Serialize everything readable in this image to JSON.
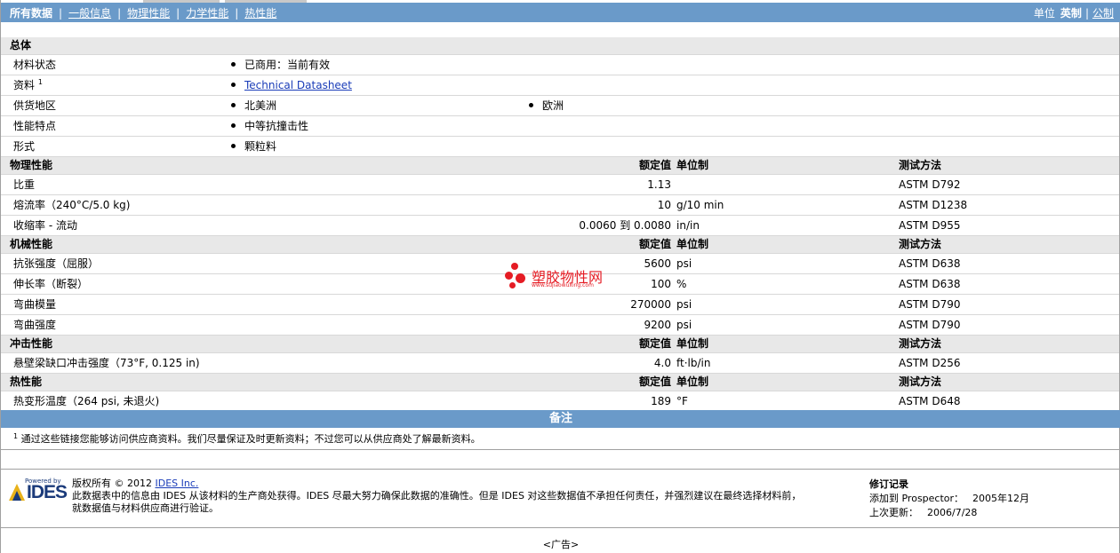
{
  "nav": {
    "items": [
      {
        "label": "所有数据",
        "active": true
      },
      {
        "label": "一般信息",
        "active": false
      },
      {
        "label": "物理性能",
        "active": false
      },
      {
        "label": "力学性能",
        "active": false
      },
      {
        "label": "热性能",
        "active": false
      }
    ],
    "unit_label": "单位",
    "unit_english": "英制",
    "unit_metric": "公制"
  },
  "general": {
    "header": "总体",
    "rows": [
      {
        "name": "材料状态",
        "values": [
          "已商用：当前有效"
        ]
      },
      {
        "name": "资料",
        "sup": "1",
        "values": [],
        "link": "Technical Datasheet"
      },
      {
        "name": "供货地区",
        "values": [
          "北美洲",
          "欧洲"
        ]
      },
      {
        "name": "性能特点",
        "values": [
          "中等抗撞击性"
        ]
      },
      {
        "name": "形式",
        "values": [
          "颗粒料"
        ]
      }
    ]
  },
  "column_headers": {
    "value": "额定值",
    "unit": "单位制",
    "method": "测试方法"
  },
  "sections": [
    {
      "header": "物理性能",
      "rows": [
        {
          "name": "比重",
          "value": "1.13",
          "unit": "",
          "method": "ASTM D792"
        },
        {
          "name": "熔流率（240°C/5.0 kg)",
          "value": "10",
          "unit": "g/10 min",
          "method": "ASTM D1238"
        },
        {
          "name": "收缩率 - 流动",
          "value": "0.0060 到  0.0080",
          "unit": "in/in",
          "method": "ASTM D955"
        }
      ]
    },
    {
      "header": "机械性能",
      "rows": [
        {
          "name": "抗张强度（屈服）",
          "value": "5600",
          "unit": "psi",
          "method": "ASTM D638"
        },
        {
          "name": "伸长率（断裂）",
          "value": "100",
          "unit": "%",
          "method": "ASTM D638"
        },
        {
          "name": "弯曲模量",
          "value": "270000",
          "unit": "psi",
          "method": "ASTM D790"
        },
        {
          "name": "弯曲强度",
          "value": "9200",
          "unit": "psi",
          "method": "ASTM D790"
        }
      ]
    },
    {
      "header": "冲击性能",
      "rows": [
        {
          "name": "悬壁梁缺口冲击强度（73°F, 0.125 in)",
          "value": "4.0",
          "unit": "ft·lb/in",
          "method": "ASTM D256"
        }
      ]
    },
    {
      "header": "热性能",
      "rows": [
        {
          "name": "热变形温度（264 psi, 未退火)",
          "value": "189",
          "unit": "°F",
          "method": "ASTM D648"
        }
      ]
    }
  ],
  "watermark": {
    "name": "塑胶物性网",
    "url": "www.sujiaowuxing.com",
    "color": "#e51c24"
  },
  "notes": {
    "header": "备注",
    "footnote_num": "1",
    "footnote": "通过这些链接您能够访问供应商资料。我们尽量保证及时更新资料；不过您可以从供应商处了解最新资料。"
  },
  "footer": {
    "powered_by": "Powered by",
    "logo_text": "IDES",
    "copyright_prefix": "版权所有  © 2012 ",
    "company_link": "IDES Inc.",
    "disclaimer_line1": "此数据表中的信息由  IDES 从该材料的生产商处获得。IDES 尽最大努力确保此数据的准确性。但是  IDES 对这些数据值不承担任何责任，并强烈建议在最终选择材料前，",
    "disclaimer_line2": "就数据值与材料供应商进行验证。"
  },
  "revision": {
    "title": "修订记录",
    "added_label": "添加到  Prospector：",
    "added_value": "2005年12月",
    "updated_label": "上次更新：",
    "updated_value": "2006/7/28"
  },
  "ad": "<广告>",
  "colors": {
    "bar": "#6a9ac9",
    "header_row": "#e8e8e8",
    "link": "#1a3cb8"
  }
}
